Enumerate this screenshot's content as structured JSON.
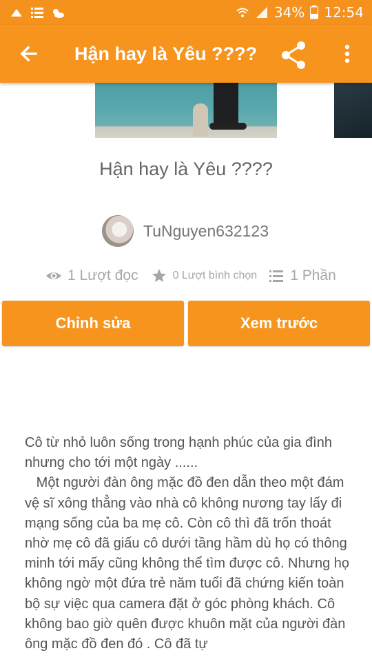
{
  "status_bar": {
    "battery_percent": "34%",
    "time": "12:54",
    "left_icons": [
      "upload-icon",
      "list-icon",
      "weather-icon"
    ],
    "right_icons": [
      "wifi-icon",
      "signal-icon",
      "battery-icon"
    ]
  },
  "toolbar": {
    "title": "Hận hay là Yêu ????",
    "back_icon": "arrow-back-icon",
    "share_icon": "share-icon",
    "more_icon": "more-vert-icon"
  },
  "story": {
    "title": "Hận hay là Yêu ????",
    "author": "TuNguyen632123",
    "stats": {
      "reads": "1 Lượt đọc",
      "votes": "0 Lượt bình chọn",
      "parts": "1 Phần"
    },
    "buttons": {
      "edit": "Chỉnh sửa",
      "preview": "Xem trước"
    },
    "description": "Cô từ nhỏ luôn sống trong hạnh phúc của gia đình nhưng cho tới một ngày ......\n   Một người đàn ông mặc đồ đen dẫn theo một đám vệ sĩ xông thẳng vào nhà cô không nương tay lấy đi mạng sống của ba mẹ cô. Còn cô thì đã trốn thoát nhờ mẹ cô đã giấu cô dưới tầng hầm dù họ có thông minh tới mấy cũng không thể tìm được cô. Nhưng họ không ngờ một đứa trẻ năm tuổi đã chứng kiến toàn bộ sự việc qua camera đặt ở góc phòng khách. Cô không bao giờ quên được khuôn mặt của người đàn ông mặc đồ đen đó . Cô đã tự"
  },
  "colors": {
    "accent": "#f7941d",
    "text_muted": "#a7a7a7",
    "text_body": "#555555"
  }
}
